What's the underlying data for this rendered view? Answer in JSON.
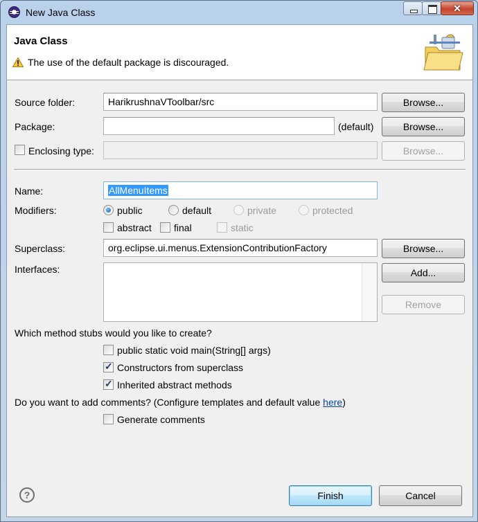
{
  "window": {
    "title": "New Java Class"
  },
  "banner": {
    "title": "Java Class",
    "message": "The use of the default package is discouraged.",
    "image": "folder-class-wizard-icon"
  },
  "source_folder": {
    "label": "Source folder:",
    "value": "HarikrushnaVToolbar/src",
    "browse": "Browse..."
  },
  "package": {
    "label": "Package:",
    "value": "",
    "hint": "(default)",
    "browse": "Browse..."
  },
  "enclosing_type": {
    "label": "Enclosing type:",
    "checked": false,
    "value": "",
    "browse": "Browse..."
  },
  "name": {
    "label": "Name:",
    "value": "AllMenuItems"
  },
  "modifiers": {
    "label": "Modifiers:",
    "visibility": [
      {
        "label": "public",
        "selected": true,
        "enabled": true
      },
      {
        "label": "default",
        "selected": false,
        "enabled": true
      },
      {
        "label": "private",
        "selected": false,
        "enabled": false
      },
      {
        "label": "protected",
        "selected": false,
        "enabled": false
      }
    ],
    "flags": [
      {
        "label": "abstract",
        "checked": false,
        "enabled": true
      },
      {
        "label": "final",
        "checked": false,
        "enabled": true
      },
      {
        "label": "static",
        "checked": false,
        "enabled": false
      }
    ]
  },
  "superclass": {
    "label": "Superclass:",
    "value": "org.eclipse.ui.menus.ExtensionContributionFactory",
    "browse": "Browse..."
  },
  "interfaces": {
    "label": "Interfaces:",
    "add": "Add...",
    "remove": "Remove"
  },
  "stubs": {
    "question": "Which method stubs would you like to create?",
    "options": [
      {
        "label": "public static void main(String[] args)",
        "checked": false
      },
      {
        "label": "Constructors from superclass",
        "checked": true
      },
      {
        "label": "Inherited abstract methods",
        "checked": true
      }
    ]
  },
  "comments": {
    "question_prefix": "Do you want to add comments? (Configure templates and default value ",
    "link": "here",
    "question_suffix": ")",
    "option": "Generate comments",
    "checked": false
  },
  "footer": {
    "finish": "Finish",
    "cancel": "Cancel",
    "help_icon": "help-icon"
  }
}
